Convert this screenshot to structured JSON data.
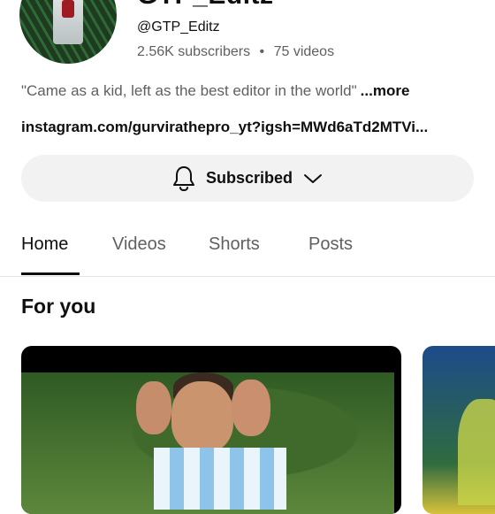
{
  "channel": {
    "title_partial": "GTP_Editz",
    "handle": "@GTP_Editz",
    "subscribers": "2.56K subscribers",
    "videos": "75 videos",
    "separator": "•",
    "description": "\"Came as a kid, left as the best editor in the world\"",
    "more_label": "...more",
    "link": "instagram.com/gurvirathepro_yt?igsh=MWd6aTd2MTVi..."
  },
  "subscribe": {
    "label": "Subscribed",
    "icons": [
      "bell-icon",
      "chevron-down-icon"
    ]
  },
  "tabs": [
    {
      "label": "Home",
      "active": true
    },
    {
      "label": "Videos",
      "active": false
    },
    {
      "label": "Shorts",
      "active": false
    },
    {
      "label": "Posts",
      "active": false
    }
  ],
  "section": {
    "title": "For you"
  },
  "colors": {
    "text_primary": "#0f0f0f",
    "text_secondary": "#606060",
    "button_bg": "#f2f2f2",
    "divider": "#e5e5e5"
  }
}
